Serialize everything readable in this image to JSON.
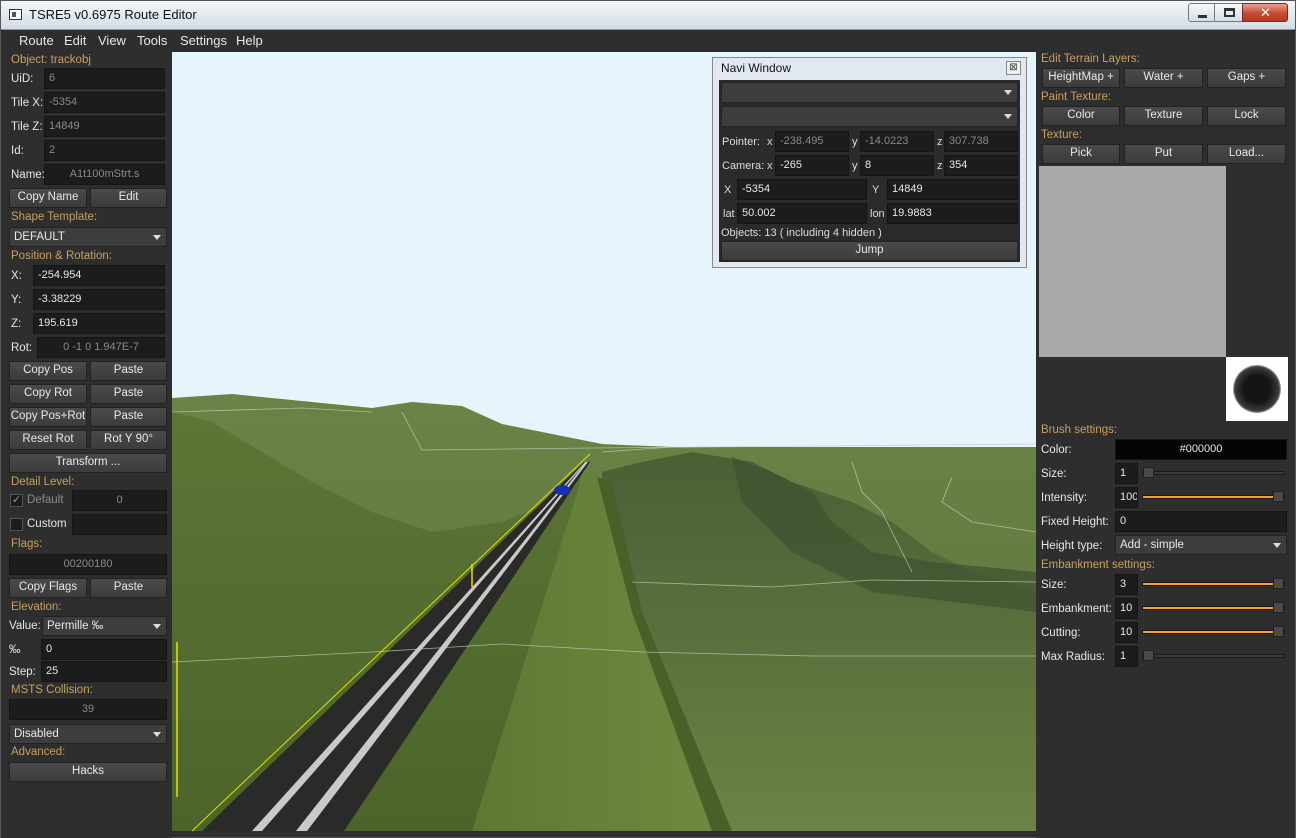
{
  "window": {
    "title": "TSRE5 v0.6975 Route Editor"
  },
  "menu": [
    "Route",
    "Edit",
    "View",
    "Tools",
    "Settings",
    "Help"
  ],
  "left": {
    "object_header": "Object: trackobj",
    "uid_label": "UiD:",
    "uid": "6",
    "tilex_label": "Tile X:",
    "tilex": "-5354",
    "tilez_label": "Tile Z:",
    "tilez": "14849",
    "id_label": "Id:",
    "id": "2",
    "name_label": "Name:",
    "name": "A1t100mStrt.s",
    "copy_name": "Copy Name",
    "edit": "Edit",
    "shape_template_header": "Shape Template:",
    "shape_template": "DEFAULT",
    "pos_rot_header": "Position & Rotation:",
    "x_label": "X:",
    "x": "-254.954",
    "y_label": "Y:",
    "y": "-3.38229",
    "z_label": "Z:",
    "z": "195.619",
    "rot_label": "Rot:",
    "rot": "0 -1 0 1.947E-7",
    "copy_pos": "Copy Pos",
    "paste1": "Paste",
    "copy_rot": "Copy Rot",
    "paste2": "Paste",
    "copy_pos_rot": "Copy Pos+Rot",
    "paste3": "Paste",
    "reset_rot": "Reset Rot",
    "rot_y_90": "Rot Y 90°",
    "transform": "Transform ...",
    "detail_level_header": "Detail Level:",
    "default_label": "Default",
    "default_value": "0",
    "custom_label": "Custom",
    "flags_header": "Flags:",
    "flags": "00200180",
    "copy_flags": "Copy Flags",
    "paste4": "Paste",
    "elevation_header": "Elevation:",
    "value_label": "Value:",
    "value_mode": "Permille ‰",
    "permille_label": "‰",
    "permille": "0",
    "step_label": "Step:",
    "step": "25",
    "msts_collision_header": "MSTS Collision:",
    "collision_value": "39",
    "collision_mode": "Disabled",
    "advanced_header": "Advanced:",
    "hacks": "Hacks"
  },
  "navi": {
    "title": "Navi Window",
    "pointer_label": "Pointer:",
    "pointer_x": "-238.495",
    "pointer_y": "-14.0223",
    "pointer_z": "307.738",
    "camera_label": "Camera:",
    "camera_x": "-265",
    "camera_y": "8",
    "camera_z": "354",
    "X": "-5354",
    "Y": "14849",
    "lat_label": "lat",
    "lat": "50.002",
    "lon_label": "lon",
    "lon": "19.9883",
    "objects": "Objects: 13 ( including 4 hidden )",
    "jump": "Jump",
    "x_lbl": "x",
    "y_lbl": "y",
    "z_lbl": "z",
    "X_lbl": "X",
    "Y_lbl": "Y"
  },
  "right": {
    "edit_layers_header": "Edit Terrain Layers:",
    "heightmap": "HeightMap +",
    "water": "Water +",
    "gaps": "Gaps +",
    "paint_header": "Paint Texture:",
    "color_btn": "Color",
    "texture_btn": "Texture",
    "lock_btn": "Lock",
    "texture_header": "Texture:",
    "pick": "Pick",
    "put": "Put",
    "load": "Load...",
    "brush_header": "Brush settings:",
    "color_label": "Color:",
    "color_value": "#000000",
    "size_label": "Size:",
    "size": "1",
    "size_level": 0.0,
    "intensity_label": "Intensity:",
    "intensity": "100",
    "intensity_level": 1.0,
    "fixed_height_label": "Fixed Height:",
    "fixed_height": "0",
    "height_type_label": "Height type:",
    "height_type": "Add - simple",
    "embankment_header": "Embankment settings:",
    "emb_size_label": "Size:",
    "emb_size": "3",
    "emb_size_level": 1.0,
    "embankment_label": "Embankment:",
    "embankment": "10",
    "embankment_level": 1.0,
    "cutting_label": "Cutting:",
    "cutting": "10",
    "cutting_level": 1.0,
    "max_radius_label": "Max Radius:",
    "max_radius": "1",
    "max_radius_level": 0.0
  },
  "colors": {
    "accent": "#f5a030",
    "section": "#c8a060",
    "panel": "#2e2e2e",
    "sky": "#e6f4fb",
    "grass": "#5f7a38"
  }
}
